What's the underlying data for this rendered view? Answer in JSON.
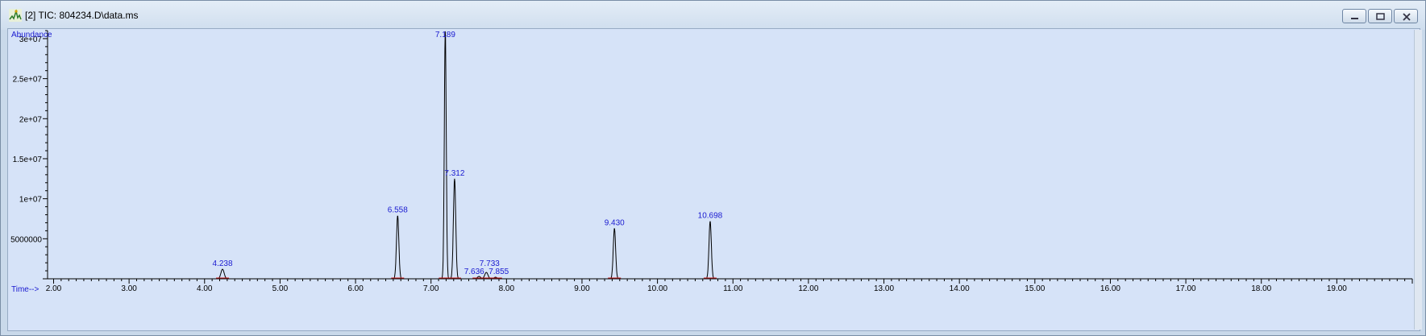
{
  "window": {
    "title": "[2] TIC: 804234.D\\data.ms",
    "icon": "chromatogram-icon",
    "buttons": [
      "minimize-icon",
      "restore-icon",
      "close-icon"
    ]
  },
  "chart_data": {
    "type": "line",
    "title": "",
    "xlabel": "Time-->",
    "ylabel": "Abundance",
    "xlim": [
      1.92,
      20.0
    ],
    "ylim": [
      0,
      31000000
    ],
    "x_ticks": [
      2,
      3,
      4,
      5,
      6,
      7,
      8,
      9,
      10,
      11,
      12,
      13,
      14,
      15,
      16,
      17,
      18,
      19
    ],
    "x_tick_labels": [
      "2.00",
      "3.00",
      "4.00",
      "5.00",
      "6.00",
      "7.00",
      "8.00",
      "9.00",
      "10.00",
      "11.00",
      "12.00",
      "13.00",
      "14.00",
      "15.00",
      "16.00",
      "17.00",
      "18.00",
      "19.00"
    ],
    "y_ticks": [
      5000000,
      10000000,
      15000000,
      20000000,
      25000000,
      30000000
    ],
    "y_tick_labels": [
      "5000000",
      "1e+07",
      "1.5e+07",
      "2e+07",
      "2.5e+07",
      "3e+07"
    ],
    "grid": false,
    "series": [
      {
        "peaks": [
          {
            "x": 4.238,
            "y": 1200000,
            "label": "4.238"
          },
          {
            "x": 6.558,
            "y": 7900000,
            "label": "6.558"
          },
          {
            "x": 7.189,
            "y": 31000000,
            "label": "7.189"
          },
          {
            "x": 7.312,
            "y": 12500000,
            "label": "7.312"
          },
          {
            "x": 7.636,
            "y": 300000,
            "label": "7.636"
          },
          {
            "x": 7.733,
            "y": 800000,
            "label": "7.733"
          },
          {
            "x": 7.855,
            "y": 200000,
            "label": "7.855"
          },
          {
            "x": 9.43,
            "y": 6300000,
            "label": "9.430"
          },
          {
            "x": 10.698,
            "y": 7200000,
            "label": "10.698"
          }
        ]
      }
    ],
    "colors": {
      "background": "#d6e3f8",
      "trace": "#000000",
      "labels": "#1a1ad0",
      "integration_baseline": "#d02020"
    }
  }
}
